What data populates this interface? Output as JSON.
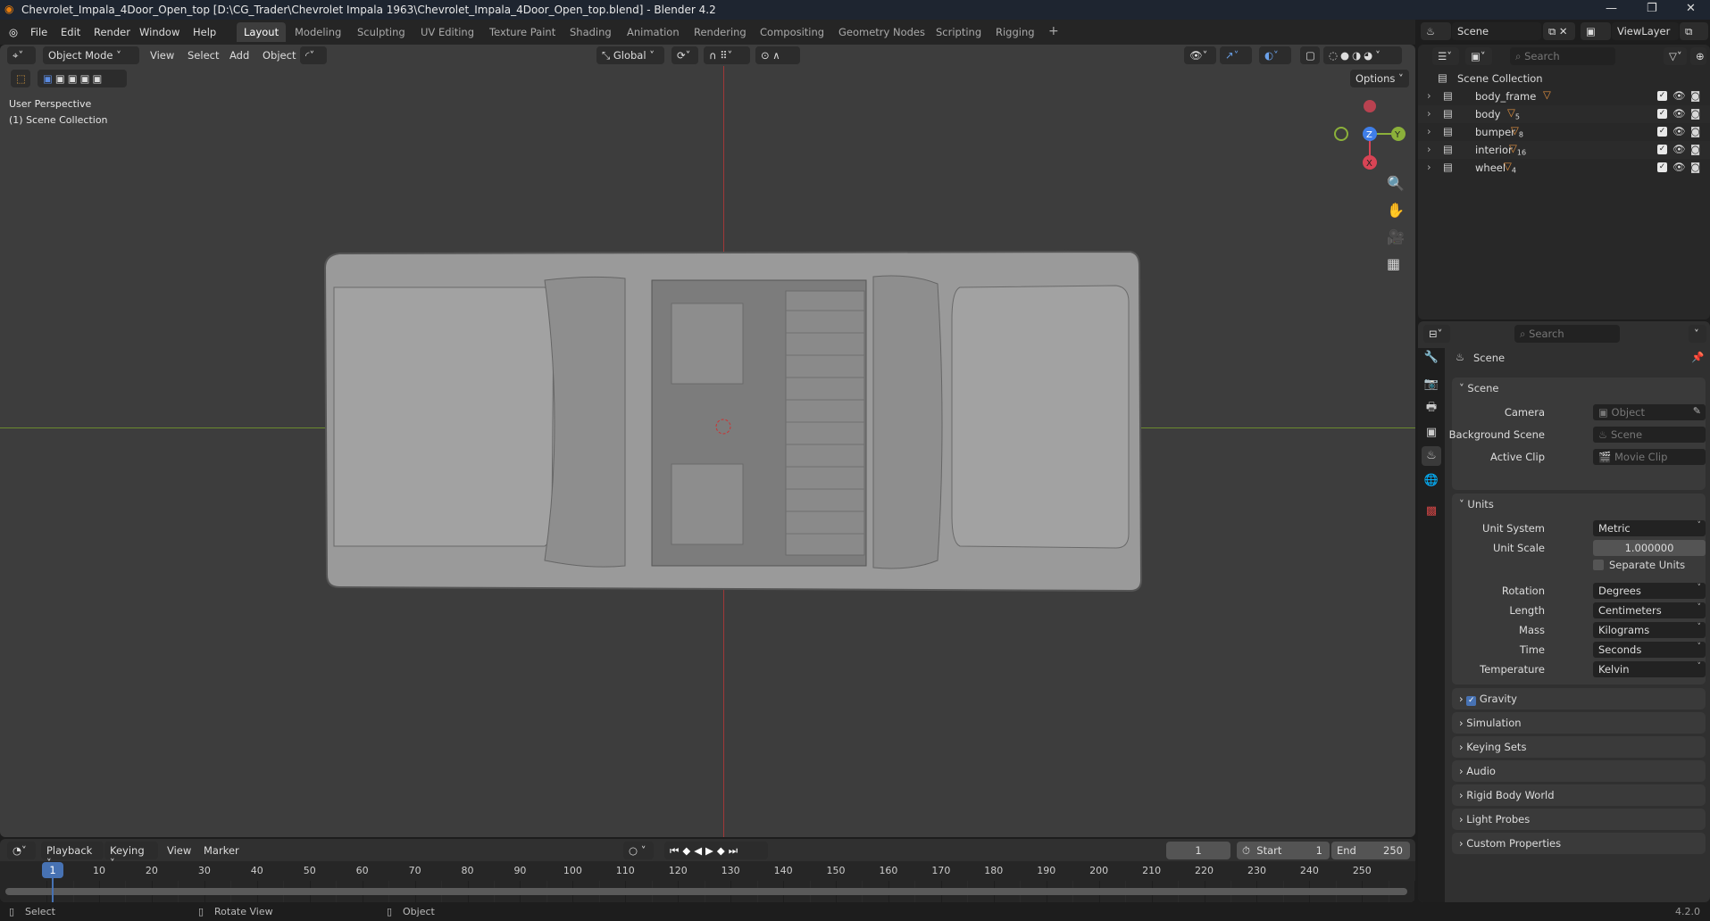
{
  "window": {
    "title": "Chevrolet_Impala_4Door_Open_top [D:\\CG_Trader\\Chevrolet Impala 1963\\Chevrolet_Impala_4Door_Open_top.blend] - Blender 4.2"
  },
  "menu": [
    "File",
    "Edit",
    "Render",
    "Window",
    "Help"
  ],
  "workspaces": [
    "Layout",
    "Modeling",
    "Sculpting",
    "UV Editing",
    "Texture Paint",
    "Shading",
    "Animation",
    "Rendering",
    "Compositing",
    "Geometry Nodes",
    "Scripting",
    "Rigging"
  ],
  "active_workspace": "Layout",
  "viewport": {
    "mode": "Object Mode",
    "menus": [
      "View",
      "Select",
      "Add",
      "Object"
    ],
    "orientation": "Global",
    "options": "Options",
    "overlay_line1": "User Perspective",
    "overlay_line2": "(1) Scene Collection",
    "gizmo": {
      "x": "X",
      "y": "Y",
      "z": "Z"
    }
  },
  "topright": {
    "scene": "Scene",
    "view_layer": "ViewLayer"
  },
  "outliner": {
    "search_placeholder": "Search",
    "root": "Scene Collection",
    "items": [
      {
        "name": "body_frame",
        "count": ""
      },
      {
        "name": "body",
        "count": "5"
      },
      {
        "name": "bumper",
        "count": "8"
      },
      {
        "name": "interior",
        "count": "16"
      },
      {
        "name": "wheel",
        "count": "4"
      }
    ]
  },
  "properties": {
    "search_placeholder": "Search",
    "context": "Scene",
    "scene_panel": {
      "title": "Scene",
      "camera_label": "Camera",
      "camera_ph": "Object",
      "bg_label": "Background Scene",
      "bg_ph": "Scene",
      "clip_label": "Active Clip",
      "clip_ph": "Movie Clip"
    },
    "units_panel": {
      "title": "Units",
      "rows": [
        {
          "label": "Unit System",
          "value": "Metric"
        },
        {
          "label": "Unit Scale",
          "value": "1.000000"
        },
        {
          "label": "Rotation",
          "value": "Degrees"
        },
        {
          "label": "Length",
          "value": "Centimeters"
        },
        {
          "label": "Mass",
          "value": "Kilograms"
        },
        {
          "label": "Time",
          "value": "Seconds"
        },
        {
          "label": "Temperature",
          "value": "Kelvin"
        }
      ],
      "separate_units": "Separate Units"
    },
    "collapsed": [
      "Gravity",
      "Simulation",
      "Keying Sets",
      "Audio",
      "Rigid Body World",
      "Light Probes",
      "Custom Properties"
    ]
  },
  "timeline": {
    "menus": [
      "Playback",
      "Keying",
      "View",
      "Marker"
    ],
    "current_frame": "1",
    "start_label": "Start",
    "start": "1",
    "end_label": "End",
    "end": "250",
    "ticks": [
      10,
      20,
      30,
      40,
      50,
      60,
      70,
      80,
      90,
      100,
      110,
      120,
      130,
      140,
      150,
      160,
      170,
      180,
      190,
      200,
      210,
      220,
      230,
      240,
      250
    ]
  },
  "status": {
    "select": "Select",
    "rotate": "Rotate View",
    "object": "Object",
    "version": "4.2.0"
  }
}
